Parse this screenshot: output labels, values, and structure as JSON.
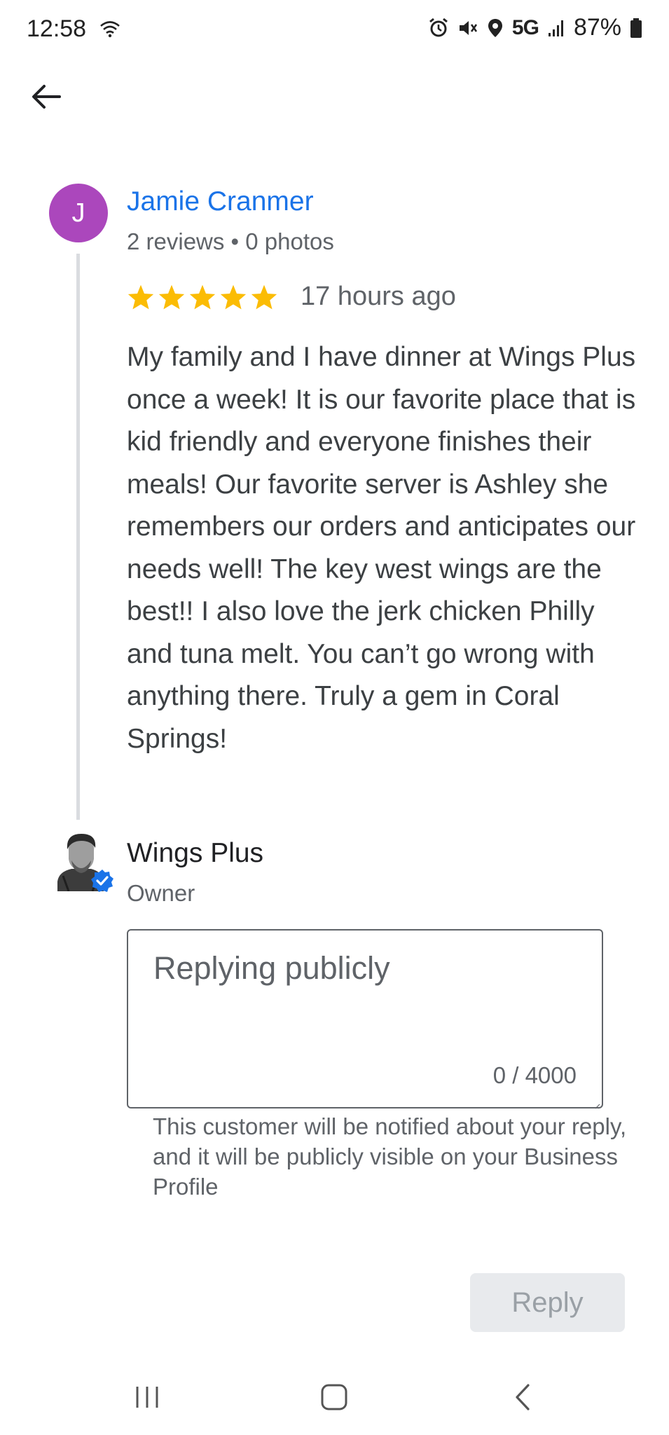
{
  "status_bar": {
    "time": "12:58",
    "network": "5G",
    "battery": "87%",
    "icons": [
      "wifi-icon",
      "alarm-icon",
      "mute-icon",
      "location-icon",
      "signal-icon",
      "battery-icon"
    ]
  },
  "top_bar": {
    "back_icon": "arrow-left-icon"
  },
  "review": {
    "avatar_initial": "J",
    "avatar_color": "#ab47bc",
    "reviewer_name": "Jamie Cranmer",
    "reviewer_meta": "2 reviews • 0 photos",
    "rating": 5,
    "rating_max": 5,
    "time": "17 hours ago",
    "text": "My family and I have dinner at Wings Plus once a week! It is our favorite place that is kid friendly and everyone finishes their meals! Our favorite server is Ashley she remembers our orders and anticipates our needs well! The key west wings are the best!! I also love the jerk chicken Philly and tuna melt. You can’t go wrong with anything there. Truly a gem in Coral Springs!"
  },
  "owner": {
    "name": "Wings Plus",
    "role": "Owner",
    "verified": true
  },
  "reply": {
    "placeholder": "Replying publicly",
    "counter": "0 / 4000",
    "helper": "This customer will be notified about your reply, and it will be publicly visible on your Business Profile",
    "button_label": "Reply"
  },
  "colors": {
    "accent": "#1a73e8",
    "star": "#fbbc04",
    "button_disabled_bg": "#e8eaed"
  },
  "nav_bar": {
    "icons": [
      "recent-apps-icon",
      "home-icon",
      "back-icon"
    ]
  }
}
